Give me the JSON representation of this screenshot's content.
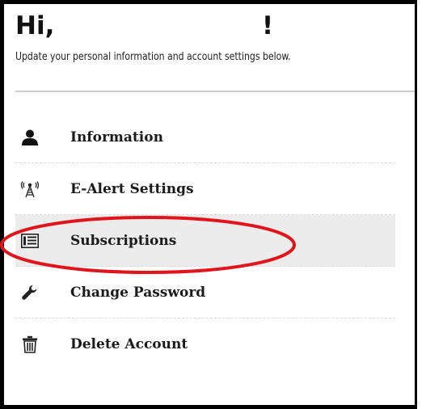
{
  "header": {
    "greeting_prefix": "Hi,",
    "greeting_suffix": "!",
    "subtitle": "Update your personal information and account settings below."
  },
  "menu": {
    "items": [
      {
        "label": "Information",
        "icon": "user-icon"
      },
      {
        "label": "E-Alert Settings",
        "icon": "antenna-icon"
      },
      {
        "label": "Subscriptions",
        "icon": "newspaper-icon",
        "active": true
      },
      {
        "label": "Change Password",
        "icon": "wrench-icon"
      },
      {
        "label": "Delete Account",
        "icon": "trash-icon"
      }
    ]
  },
  "annotation": {
    "color": "#e0141a",
    "target": "Subscriptions"
  }
}
